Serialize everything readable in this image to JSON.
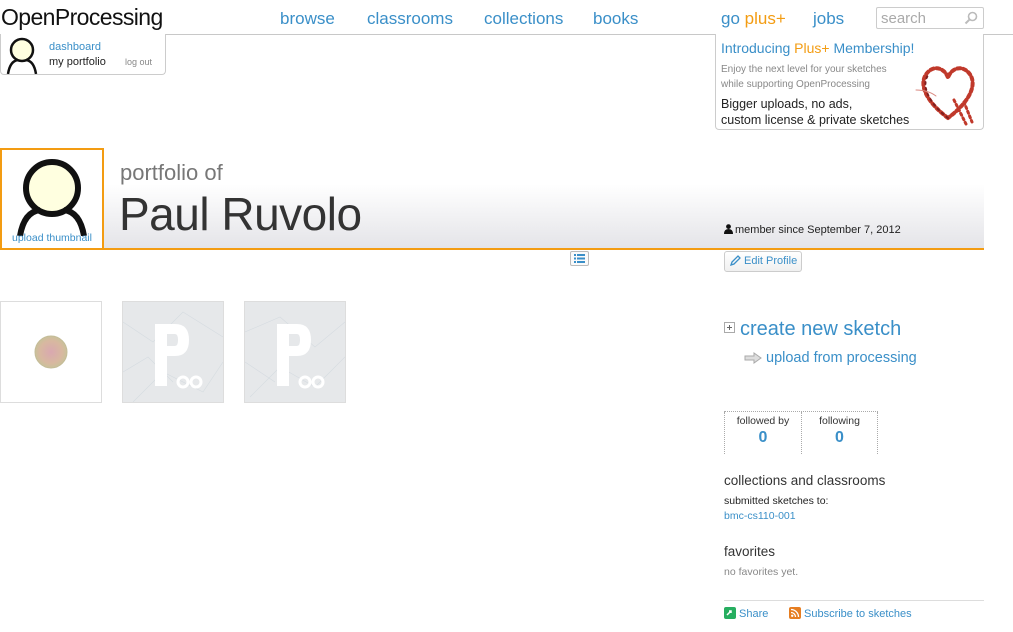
{
  "header": {
    "logo": "OpenProcessing",
    "nav": {
      "browse": "browse",
      "classrooms": "classrooms",
      "collections": "collections",
      "books": "books",
      "go": "go",
      "plus": "plus+",
      "jobs": "jobs"
    },
    "search_placeholder": "search"
  },
  "user_panel": {
    "dashboard": "dashboard",
    "my_portfolio": "my portfolio",
    "log_out": "log out"
  },
  "promo": {
    "title_pre": "Introducing",
    "title_plus": "Plus+",
    "title_post": "Membership!",
    "sub_line1": "Enjoy the next level for your sketches",
    "sub_line2": "while supporting OpenProcessing",
    "bold_line1": "Bigger uploads, no ads,",
    "bold_line2": "custom license & private sketches"
  },
  "profile": {
    "upload_thumbnail": "upload thumbnail",
    "portfolio_of": "portfolio of",
    "name": "Paul Ruvolo",
    "member_since": "member since September 7, 2012",
    "edit_profile": "Edit Profile"
  },
  "sidebar": {
    "create_new_sketch": "create new sketch",
    "upload_from_processing": "upload from processing",
    "followed_by_label": "followed by",
    "followed_by_count": "0",
    "following_label": "following",
    "following_count": "0",
    "collections_title": "collections and classrooms",
    "submitted_to": "submitted sketches to:",
    "classroom": "bmc-cs110-001",
    "favorites_title": "favorites",
    "no_favorites": "no favorites yet.",
    "share": "Share",
    "subscribe": "Subscribe to sketches"
  },
  "colors": {
    "link_blue": "#3a8fc8",
    "accent_orange": "#f39c12"
  }
}
